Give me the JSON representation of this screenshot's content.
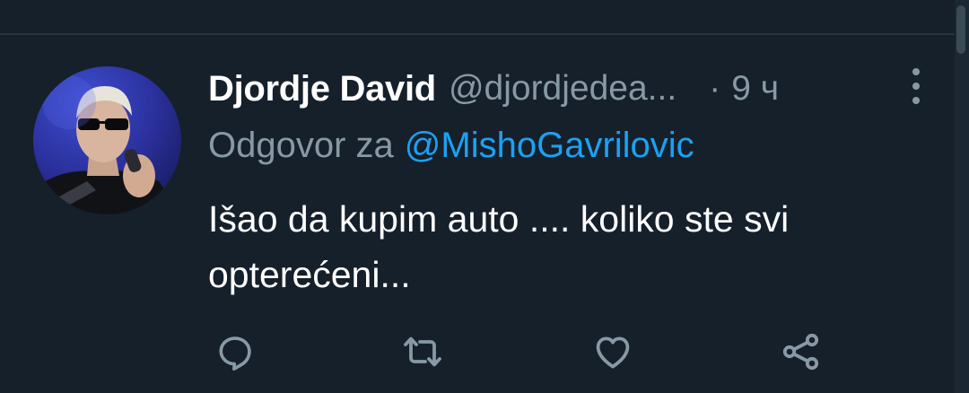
{
  "tweet": {
    "author_name": "Djordje David",
    "author_handle": "@djordjedea...",
    "separator": "·",
    "time": "9 ч",
    "reply_prefix": "Odgovor za",
    "reply_mention": "@MishoGavrilovic",
    "text": "Išao da kupim auto .... koliko ste svi opterećeni..."
  },
  "actions": [
    {
      "icon": "reply-icon"
    },
    {
      "icon": "retweet-icon"
    },
    {
      "icon": "like-icon"
    },
    {
      "icon": "share-icon"
    }
  ],
  "colors": {
    "background": "#15202b",
    "primary_text": "#ffffff",
    "secondary_text": "#8899a6",
    "link": "#1da1f2"
  }
}
